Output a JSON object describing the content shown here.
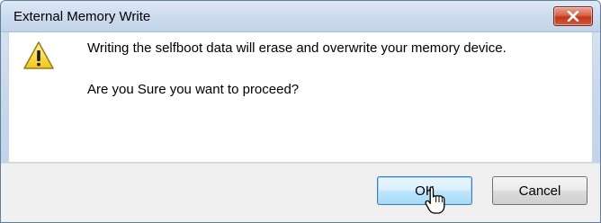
{
  "window": {
    "title": "External Memory Write",
    "close_icon": "close-icon"
  },
  "message": {
    "icon": "warning-icon",
    "line1": "Writing the selfboot data will erase and overwrite your memory device.",
    "line2": "Are you Sure you want to proceed?"
  },
  "buttons": {
    "ok_label": "OK",
    "cancel_label": "Cancel"
  },
  "colors": {
    "close_button": "#c94a2c",
    "warning_fill": "#f5d21f",
    "focus_border": "#3c7fb1"
  }
}
